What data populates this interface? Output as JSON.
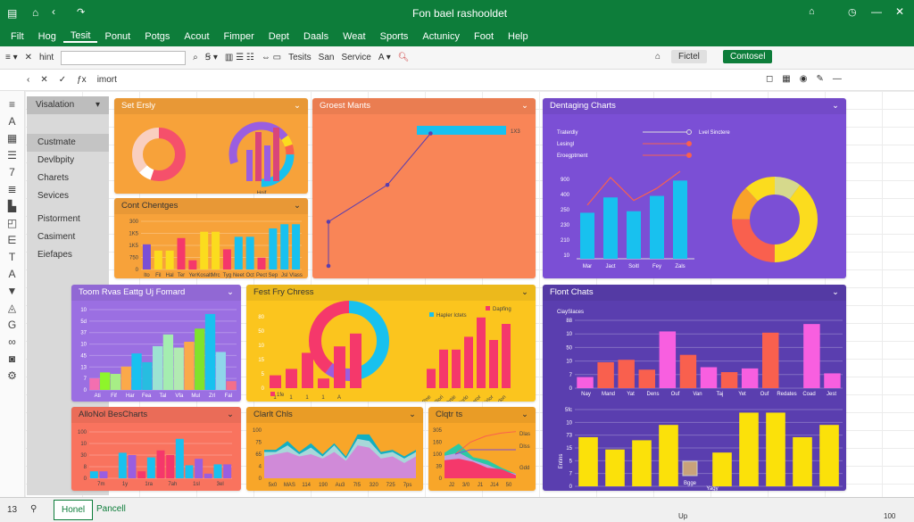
{
  "window": {
    "title": "Fon bael rashooldet",
    "icons": [
      "save-icon",
      "home-icon",
      "back-icon",
      "redo-icon",
      "share-icon",
      "history-icon",
      "minimize-icon",
      "close-icon"
    ]
  },
  "menu": [
    "Filt",
    "Hog",
    "Tesit",
    "Ponut",
    "Potgs",
    "Acout",
    "Fimper",
    "Dept",
    "Daals",
    "Weat",
    "Sports",
    "Actunicy",
    "Foot",
    "Help"
  ],
  "menu_active": 2,
  "toolbar": {
    "font": "hint",
    "font_box": "",
    "items": [
      "Tesits",
      "San",
      "Service"
    ],
    "view_label": "Fictel",
    "contact_label": "Contosel"
  },
  "formula": {
    "value": "imort"
  },
  "sidebar": {
    "header": "Visalation",
    "items": [
      "Custmate",
      "Devlbpity",
      "Charets",
      "Sevices",
      "Pistorment",
      "Casiment",
      "Eiefapes"
    ],
    "selected": 0
  },
  "colors": {
    "brand": "#0d7d3a",
    "orange": "#f7a23a",
    "coral": "#f98557",
    "purple": "#7b4fd5",
    "yellow": "#fbc51e",
    "deep_purple": "#5a3eaf",
    "salmon": "#f9735e",
    "cyan": "#18c1ef",
    "pink": "#f5386b"
  },
  "panels": {
    "p1": {
      "title": "Set Ersly",
      "caption": "Hoif"
    },
    "p2": {
      "title": "Cont Chentges"
    },
    "p3": {
      "title": "Groest Mants",
      "bar_label": "1X3"
    },
    "p4": {
      "title": "Dentaging Charts",
      "legend": [
        "Traterdly",
        "Lesingl",
        "Eroegptment"
      ],
      "legend_right": "Lvel Sinctere"
    },
    "p5": {
      "title": "Toom Rvas Eattg Uj Fomard"
    },
    "p6": {
      "title": "Fest Fry Chress",
      "legend": [
        "Hapler Ictets",
        "Dapfing"
      ],
      "legend_small": "1fe"
    },
    "p7": {
      "title": "Flont Chats",
      "subtitle": "CiaySlaces",
      "ylabel": "Entins",
      "img_caption": "Bgge",
      "xcaption": "Yagy"
    },
    "p8": {
      "title": "AlloNol BesCharts"
    },
    "p9": {
      "title": "Clarlt Chls"
    },
    "p10": {
      "title": "Clqtr ts",
      "series_labels": [
        "Dlas",
        "Dlss",
        "Gdd"
      ]
    }
  },
  "chart_data": [
    {
      "id": "p2",
      "type": "bar",
      "yticks": [
        "0",
        "750",
        "1K5",
        "1K5",
        "300"
      ],
      "categories": [
        "Ito",
        "Fil",
        "Hal",
        "Ter",
        "Yer",
        "Kosalt",
        "Mrc",
        "Tyg",
        "Neet",
        "Oct",
        "Pect",
        "Sep",
        "Jsl",
        "Vlass"
      ],
      "values": [
        60,
        45,
        45,
        75,
        22,
        90,
        90,
        48,
        78,
        78,
        28,
        98,
        108,
        108
      ],
      "colors": [
        "#7b4fd5",
        "#fbdc1e",
        "#fbdc1e",
        "#f5386b",
        "#f5386b",
        "#fbdc1e",
        "#fbdc1e",
        "#f5386b",
        "#18c1ef",
        "#18c1ef",
        "#f5386b",
        "#18c1ef",
        "#18c1ef",
        "#18c1ef"
      ],
      "ymax": 115
    },
    {
      "id": "p3",
      "type": "line",
      "points": [
        [
          0,
          0
        ],
        [
          0,
          30
        ],
        [
          30,
          55
        ],
        [
          52,
          90
        ]
      ],
      "bar_value": 100
    },
    {
      "id": "p4",
      "type": "bar+line",
      "yticks": [
        "10",
        "210",
        "230",
        "250",
        "400",
        "900"
      ],
      "categories": [
        "Mar",
        "Jact",
        "Soitl",
        "Fey",
        "Zals"
      ],
      "values": [
        150,
        200,
        155,
        205,
        255
      ],
      "line": [
        175,
        265,
        190,
        230,
        285
      ],
      "ymax": 320,
      "donut": [
        {
          "v": 40,
          "c": "#fbdc1e"
        },
        {
          "v": 25,
          "c": "#f9604e"
        },
        {
          "v": 13,
          "c": "#f9a22a"
        },
        {
          "v": 12,
          "c": "#fbdc1e"
        },
        {
          "v": 10,
          "c": "#d6d98c"
        }
      ]
    },
    {
      "id": "p5",
      "type": "bar",
      "yticks": [
        "0",
        "7",
        "13",
        "45",
        "10",
        "37",
        "5d",
        "10"
      ],
      "categories": [
        "Ati",
        "Fif",
        "Har",
        "Fea",
        "Tal",
        "Vfa",
        "Mul",
        "Zrl",
        "Fal"
      ],
      "values": [
        8,
        12,
        11,
        16,
        25,
        19,
        30,
        38,
        29,
        33,
        42,
        52,
        26,
        6
      ],
      "colors": [
        "#f36fb0",
        "#8ef52a",
        "#a7ee86",
        "#fba94a",
        "#18c1ef",
        "#27bde0",
        "#9ce3d2",
        "#a4edb0",
        "#b2eab2",
        "#fba94a",
        "#7fe32c",
        "#18c1ef",
        "#8fd6ea",
        "#f36f8a"
      ],
      "ymax": 55
    },
    {
      "id": "p6",
      "type": "bar+donut",
      "yticks": [
        "0",
        "5",
        "15",
        "10",
        "50",
        "80"
      ],
      "categories": [
        "1",
        "1",
        "1",
        "1",
        "A"
      ],
      "values": [
        4,
        6,
        11,
        3,
        13,
        17
      ],
      "right_categories": [
        "Pne",
        "Rori",
        "Ortie",
        "Zorlo",
        "Iiaror",
        "Zirlor",
        "Sorlon"
      ],
      "right_values": [
        6,
        12,
        12,
        16,
        22,
        15,
        20
      ],
      "ymax": 25,
      "donut": [
        {
          "v": 35,
          "c": "#18c1ef"
        },
        {
          "v": 10,
          "c": "#9a5ee0"
        },
        {
          "v": 30,
          "c": "#f5386b"
        }
      ]
    },
    {
      "id": "p7a",
      "type": "bar",
      "yticks": [
        "0",
        "7",
        "10",
        "50",
        "10",
        "88"
      ],
      "categories": [
        "Nay",
        "Mand",
        "Yat",
        "Dens",
        "Ouf",
        "Van",
        "Taj",
        "Yet",
        "Ouf",
        "Redates",
        "Coad",
        "Jest"
      ],
      "values": [
        9,
        21,
        23,
        15,
        46,
        27,
        17,
        13,
        16,
        45,
        0,
        52,
        12
      ],
      "colors": [
        "#f85fe0",
        "#f9604e",
        "#f9604e",
        "#f9604e",
        "#f85fe0",
        "#f9604e",
        "#f85fe0",
        "#f9604e",
        "#f85fe0",
        "#f9604e",
        "#f85fe0",
        "#f85fe0"
      ],
      "ymax": 55
    },
    {
      "id": "p7b",
      "type": "bar",
      "yticks": [
        "0",
        "7",
        "5",
        "15",
        "73",
        "10",
        "5fc"
      ],
      "values": [
        80,
        60,
        75,
        100,
        0,
        55,
        120,
        120,
        80,
        100
      ],
      "color": "#fbe10a",
      "ymax": 125
    },
    {
      "id": "p8",
      "type": "bar",
      "yticks": [
        "0",
        "8",
        "30",
        "10",
        "100"
      ],
      "categories": [
        "7m",
        "1y",
        "1ra",
        "7ah",
        "1sl",
        "3el"
      ],
      "values": [
        15,
        15,
        0,
        55,
        50,
        15,
        45,
        60,
        50,
        85,
        28,
        42,
        10,
        30,
        30
      ],
      "colors": [
        "#18c1ef",
        "#9a5ee0",
        "#18c1ef",
        "#18c1ef",
        "#9a5ee0",
        "#f5386b",
        "#18c1ef",
        "#f5386b",
        "#f5386b",
        "#18c1ef",
        "#18c1ef",
        "#9a5ee0",
        "#9a5ee0",
        "#18c1ef",
        "#9a5ee0"
      ],
      "ymax": 100
    },
    {
      "id": "p9",
      "type": "area",
      "yticks": [
        "0",
        "4",
        "65",
        "75",
        "100"
      ],
      "categories": [
        "5x0",
        "MAS",
        "114",
        "190",
        "Au3",
        "7I5",
        "320",
        "725",
        "7ps"
      ],
      "series": [
        [
          50,
          55,
          60,
          50,
          55,
          45,
          60,
          40,
          75,
          70,
          45,
          50,
          35,
          50
        ],
        [
          60,
          60,
          75,
          55,
          70,
          50,
          75,
          45,
          90,
          85,
          55,
          60,
          45,
          60
        ],
        [
          65,
          65,
          85,
          60,
          80,
          55,
          80,
          50,
          100,
          100,
          60,
          65,
          50,
          65
        ]
      ],
      "colors": [
        "#d08ad8",
        "#a8d7d9",
        "#12afc2"
      ],
      "ymax": 110
    },
    {
      "id": "p10",
      "type": "area",
      "yticks": [
        "0",
        "39",
        "100",
        "160",
        "305"
      ],
      "categories": [
        "J2",
        "3/0",
        "J1",
        "J14",
        "50"
      ],
      "series": [
        [
          60,
          65,
          55,
          35,
          30,
          10
        ],
        [
          75,
          85,
          60,
          45,
          25,
          15
        ],
        [
          85,
          115,
          70,
          60,
          35,
          15
        ]
      ],
      "lines": [
        [
          80,
          120,
          140,
          150,
          155
        ],
        [
          80,
          95,
          95,
          95,
          95
        ]
      ],
      "colors": [
        "#f5386b",
        "#b9a4e3",
        "#2cc9a4"
      ],
      "ymax": 160
    }
  ],
  "tabs": {
    "row": "13",
    "sheets": [
      "Honel",
      "Pancell"
    ],
    "active": 0,
    "status_center": "Up",
    "zoom": "100"
  }
}
